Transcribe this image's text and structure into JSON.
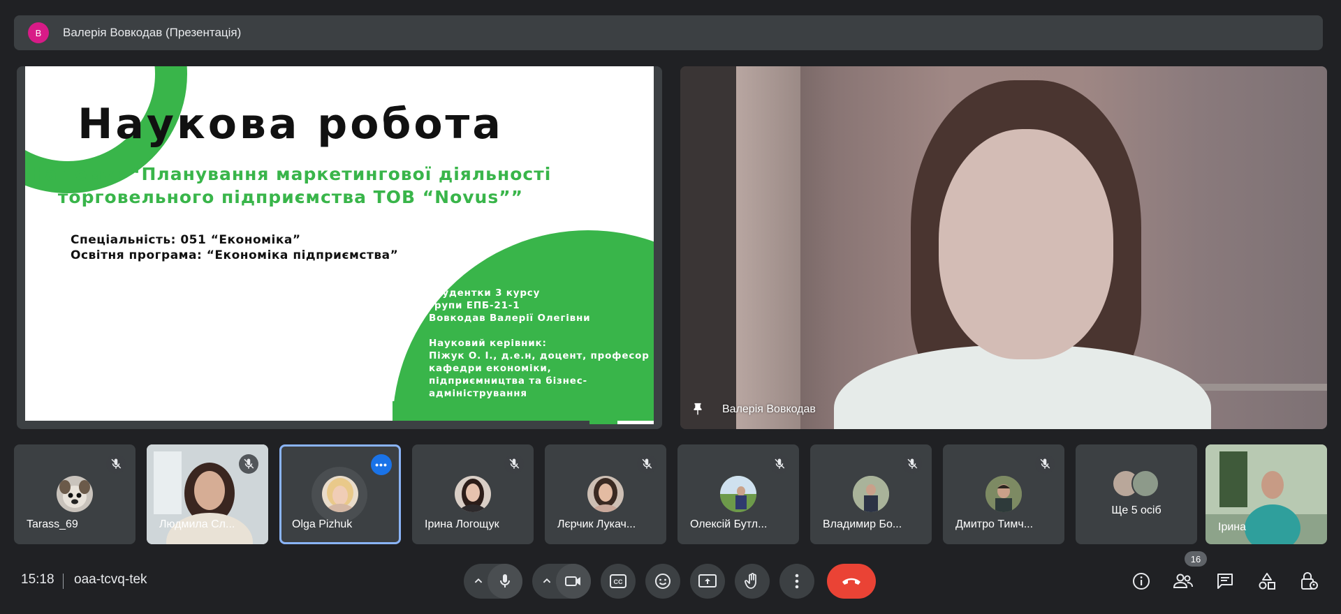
{
  "header": {
    "avatar_letter": "В",
    "title": "Валерія Вовкодав (Презентація)"
  },
  "slide": {
    "title": "Наукова робота",
    "subtitle_line1": "На тему: “Планування маркетингової діяльності",
    "subtitle_line2": "торговельного підприємства ТОВ “Novus””",
    "spec_line1": "Спеціальність: 051 “Економіка”",
    "spec_line2": "Освітня програма: “Економіка підприємства”",
    "author_lines": [
      "Студентки 3 курсу",
      "групи ЕПБ-21-1",
      "Вовкодав Валерії Олегівни",
      "",
      "Науковий керівник:",
      "Піжук О. І., д.е.н, доцент, професор",
      "кафедри економіки,",
      "підприємництва та бізнес-",
      "адміністрування"
    ],
    "accent_color": "#39b54a"
  },
  "main_video": {
    "name": "Валерія Вовкодав"
  },
  "participants": [
    {
      "name": "Tarass_69",
      "muted": true
    },
    {
      "name": "Людмила Сл...",
      "muted": true
    },
    {
      "name": "Olga Pizhuk",
      "muted": false,
      "active": true
    },
    {
      "name": "Ірина Логощук",
      "muted": true
    },
    {
      "name": "Лєрчик Лукач...",
      "muted": true
    },
    {
      "name": "Олексій Бутл...",
      "muted": true
    },
    {
      "name": "Владимир Бо...",
      "muted": true
    },
    {
      "name": "Дмитро Тимч...",
      "muted": true
    },
    {
      "name": "Ще 5 осіб"
    },
    {
      "name": "Ірина"
    }
  ],
  "footer": {
    "time": "15:18",
    "meeting_code": "oaa-tcvq-tek",
    "participants_count": "16",
    "end_call_color": "#ea4335"
  }
}
